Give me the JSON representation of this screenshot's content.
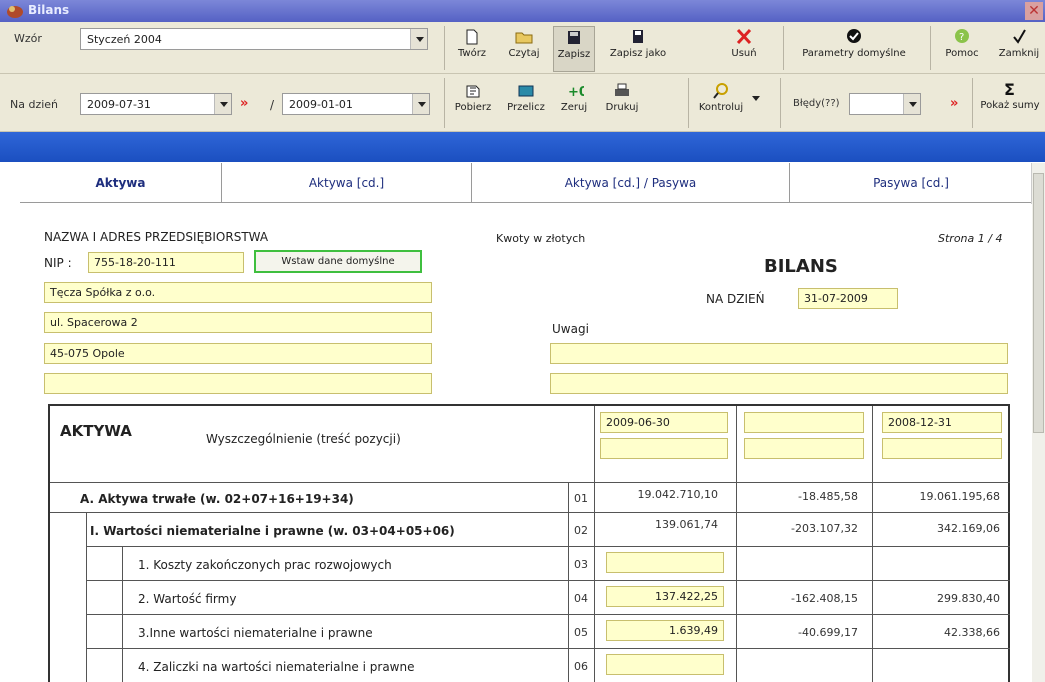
{
  "window": {
    "title": "Bilans"
  },
  "toolbar1": {
    "wzor_label": "Wzór",
    "wzor_value": "Styczeń 2004",
    "buttons": {
      "tworz": "Twórz",
      "czytaj": "Czytaj",
      "zapisz": "Zapisz",
      "zapisz_jako": "Zapisz jako",
      "usun": "Usuń",
      "parametry": "Parametry domyślne",
      "pomoc": "Pomoc",
      "zamknij": "Zamknij"
    }
  },
  "toolbar2": {
    "na_dzien_label": "Na dzień",
    "date1": "2009-07-31",
    "chevrons": "»",
    "slash": "/",
    "date2": "2009-01-01",
    "buttons": {
      "pobierz": "Pobierz",
      "przelicz": "Przelicz",
      "zeruj": "Zeruj",
      "drukuj": "Drukuj",
      "kontroluj": "Kontroluj",
      "pokaz_sumy": "Pokaż sumy"
    },
    "bledy_label": "Błędy(??)",
    "chevrons2": "»"
  },
  "tabs": [
    "Aktywa",
    "Aktywa [cd.]",
    "Aktywa [cd.] / Pasywa",
    "Pasywa [cd.]"
  ],
  "form": {
    "company_header": "NAZWA I ADRES PRZEDSIĘBIORSTWA",
    "nip_label": "NIP :",
    "nip_value": "755-18-20-111",
    "insert_defaults": "Wstaw dane domyślne",
    "address_lines": [
      "Tęcza Spółka z o.o.",
      "ul. Spacerowa 2",
      "45-075 Opole",
      ""
    ],
    "amounts_note": "Kwoty w złotych",
    "page_label": "Strona 1 / 4",
    "bilans_title": "BILANS",
    "na_dzien_label": "NA DZIEŃ",
    "na_dzien_value": "31-07-2009",
    "uwagi_label": "Uwagi",
    "uwagi_lines": [
      "",
      ""
    ]
  },
  "table": {
    "section": "AKTYWA",
    "description_header": "Wyszczególnienie (treść pozycji)",
    "col_headers": [
      "2009-06-30",
      "",
      "2008-12-31"
    ],
    "rows": [
      {
        "label": "A. Aktywa trwałe  (w. 02+07+16+19+34)",
        "code": "01",
        "v1": "19.042.710,10",
        "v2": "-18.485,58",
        "v3": "19.061.195,68"
      },
      {
        "label": "I. Wartości niematerialne i prawne (w. 03+04+05+06)",
        "code": "02",
        "v1": "139.061,74",
        "v2": "-203.107,32",
        "v3": "342.169,06"
      },
      {
        "label": "1. Koszty zakończonych prac rozwojowych",
        "code": "03",
        "v1": "",
        "v2": "",
        "v3": ""
      },
      {
        "label": "2. Wartość firmy",
        "code": "04",
        "v1": "137.422,25",
        "v2": "-162.408,15",
        "v3": "299.830,40"
      },
      {
        "label": "3.Inne wartości niematerialne i prawne",
        "code": "05",
        "v1": "1.639,49",
        "v2": "-40.699,17",
        "v3": "42.338,66"
      },
      {
        "label": "4. Zaliczki na wartości niematerialne i prawne",
        "code": "06",
        "v1": "",
        "v2": "",
        "v3": ""
      }
    ]
  },
  "colors": {
    "title_bar": "#5561c4",
    "blue_band": "#1b4fc0",
    "field": "#ffffcc",
    "accent_green": "#3fbf3f",
    "red": "#d22222"
  }
}
